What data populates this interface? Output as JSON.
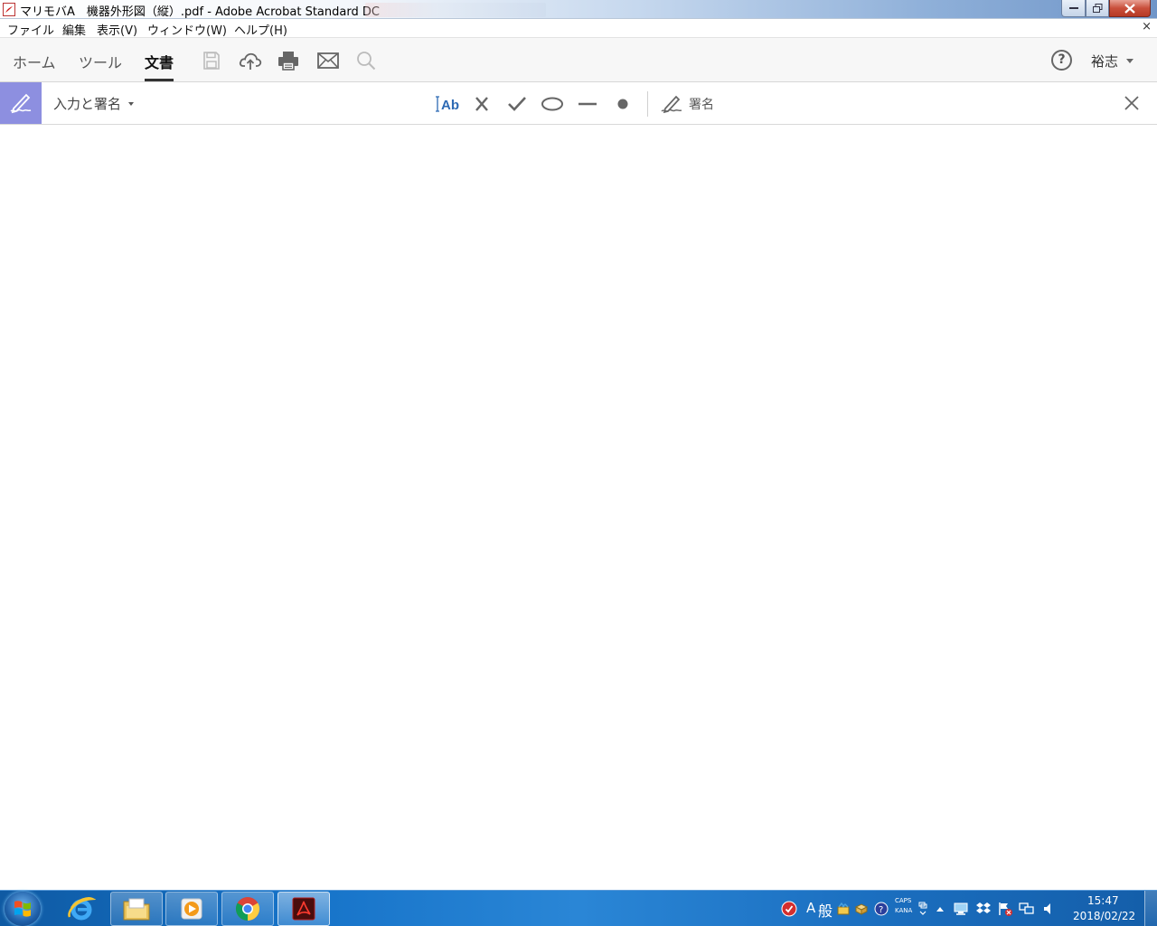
{
  "window": {
    "title": "マリモバA　機器外形図（縦）.pdf - Adobe Acrobat Standard DC"
  },
  "menu": {
    "items": [
      "ファイル",
      "編集",
      "表示(V)",
      "ウィンドウ(W)",
      "ヘルプ(H)"
    ],
    "close_glyph": "×"
  },
  "toolbar": {
    "tabs": [
      {
        "label": "ホーム",
        "active": false
      },
      {
        "label": "ツール",
        "active": false
      },
      {
        "label": "文書",
        "active": true
      }
    ],
    "icons": [
      "save-icon",
      "upload-cloud-icon",
      "print-icon",
      "email-icon",
      "search-icon"
    ],
    "help_label": "?",
    "user_name": "裕志"
  },
  "fill_sign": {
    "title": "入力と署名",
    "text_tool_label": "Ab",
    "tools": [
      "text-field-icon",
      "cross-mark-icon",
      "checkmark-icon",
      "ellipse-icon",
      "line-icon",
      "dot-icon"
    ],
    "sign_label": "署名"
  },
  "taskbar": {
    "pinned": [
      "internet-explorer-icon",
      "file-explorer-icon",
      "media-player-icon",
      "chrome-icon",
      "acrobat-icon"
    ],
    "ime_mode": "A",
    "ime_kanji": "般",
    "caps": "CAPS",
    "kana": "KANA",
    "time": "15:47",
    "date": "2018/02/22"
  },
  "colors": {
    "sign_badge": "#8d8fe0",
    "text_tool_accent": "#2d6ab4"
  }
}
